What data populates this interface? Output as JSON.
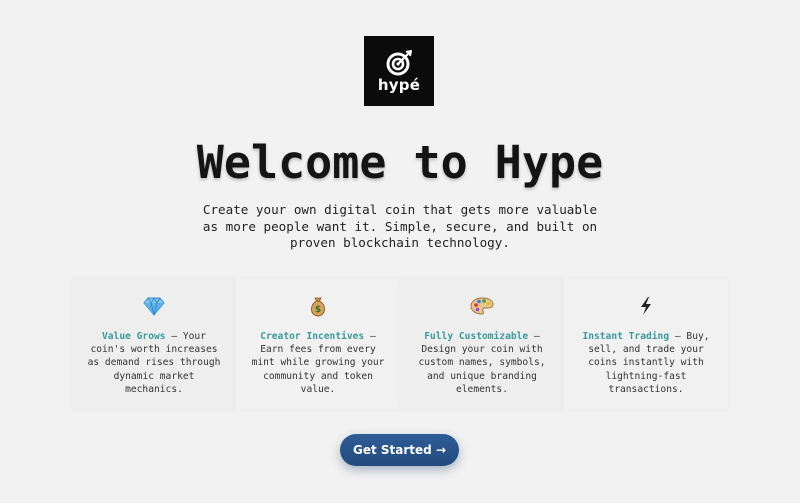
{
  "logo": {
    "text": "hypé",
    "icon": "spiral-target-icon"
  },
  "hero": {
    "title": "Welcome to Hype",
    "subtitle": "Create your own digital coin that gets more valuable as more people want it. Simple, secure, and built on proven blockchain technology."
  },
  "features": [
    {
      "icon": "gem-icon",
      "title": "Value Grows",
      "description": " — Your coin's worth increases as demand rises through dynamic market mechanics."
    },
    {
      "icon": "money-bag-icon",
      "title": "Creator Incentives",
      "description": " — Earn fees from every mint while growing your community and token value."
    },
    {
      "icon": "palette-icon",
      "title": "Fully Customizable",
      "description": " — Design your coin with custom names, symbols, and unique branding elements."
    },
    {
      "icon": "lightning-icon",
      "title": "Instant Trading",
      "description": " — Buy, sell, and trade your coins instantly with lightning-fast transactions."
    }
  ],
  "cta": {
    "label": "Get Started →"
  },
  "colors": {
    "background": "#f2f2f2",
    "accent_teal": "#3a9a9a",
    "button": "#2a5489"
  }
}
